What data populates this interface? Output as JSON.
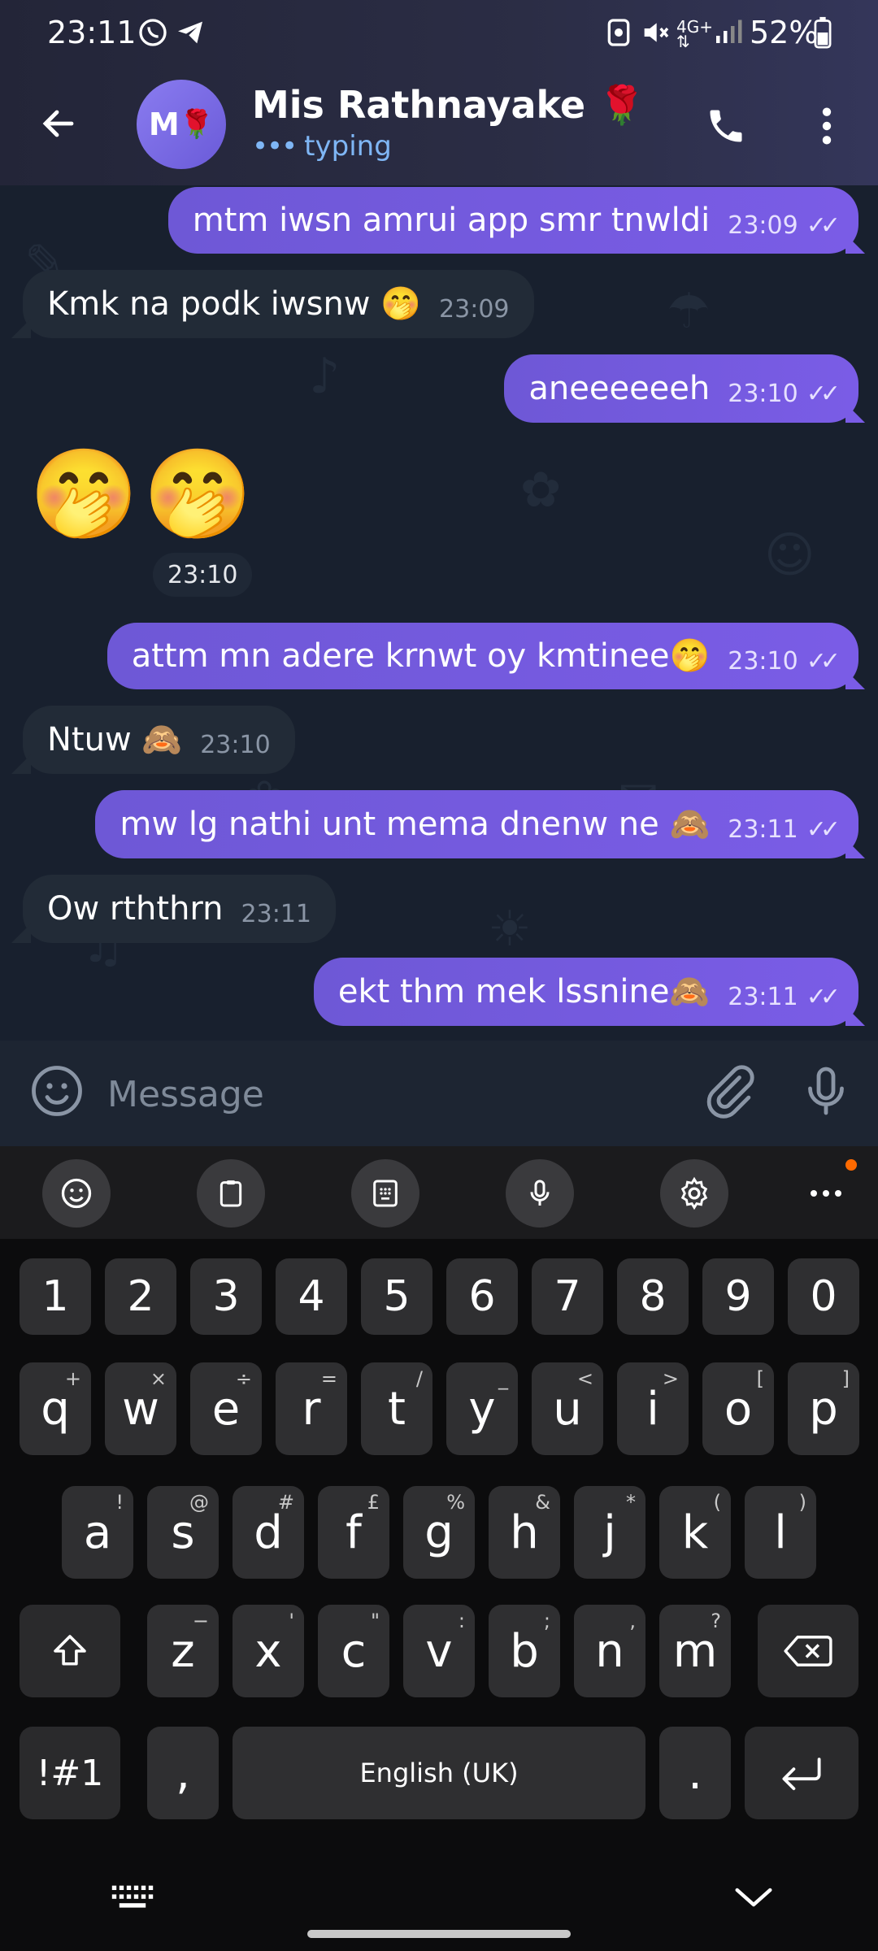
{
  "status_bar": {
    "time": "23:11",
    "battery": "52%",
    "network": "4G+"
  },
  "header": {
    "avatar_initial": "M",
    "avatar_emoji": "🌹",
    "name": "Mis Rathnayake 🌹",
    "status_text": "typing"
  },
  "messages": [
    {
      "dir": "out",
      "text": "mtm iwsn amrui app smr tnwldi",
      "time": "23:09",
      "read": true
    },
    {
      "dir": "in",
      "text": "Kmk na podk iwsnw 🤭",
      "time": "23:09"
    },
    {
      "dir": "out",
      "text": "aneeeeeeh",
      "time": "23:10",
      "read": true
    },
    {
      "dir": "in",
      "emoji_only": [
        "🤭",
        "🤭"
      ],
      "time": "23:10"
    },
    {
      "dir": "out",
      "text": "attm mn adere krnwt oy kmtinee🤭",
      "time": "23:10",
      "read": true
    },
    {
      "dir": "in",
      "text": "Ntuw 🙈",
      "time": "23:10"
    },
    {
      "dir": "out",
      "text": "mw lg nathi unt mema dnenw ne 🙈",
      "time": "23:11",
      "read": true
    },
    {
      "dir": "in",
      "text": "Ow rththrn",
      "time": "23:11"
    },
    {
      "dir": "out",
      "text": "ekt thm mek lssnine🙈",
      "time": "23:11",
      "read": true
    }
  ],
  "composer": {
    "placeholder": "Message"
  },
  "keyboard": {
    "numbers": [
      "1",
      "2",
      "3",
      "4",
      "5",
      "6",
      "7",
      "8",
      "9",
      "0"
    ],
    "row1": [
      {
        "k": "q",
        "h": "+"
      },
      {
        "k": "w",
        "h": "×"
      },
      {
        "k": "e",
        "h": "÷"
      },
      {
        "k": "r",
        "h": "="
      },
      {
        "k": "t",
        "h": "/"
      },
      {
        "k": "y",
        "h": "_"
      },
      {
        "k": "u",
        "h": "<"
      },
      {
        "k": "i",
        "h": ">"
      },
      {
        "k": "o",
        "h": "["
      },
      {
        "k": "p",
        "h": "]"
      }
    ],
    "row2": [
      {
        "k": "a",
        "h": "!"
      },
      {
        "k": "s",
        "h": "@"
      },
      {
        "k": "d",
        "h": "#"
      },
      {
        "k": "f",
        "h": "£"
      },
      {
        "k": "g",
        "h": "%"
      },
      {
        "k": "h",
        "h": "&"
      },
      {
        "k": "j",
        "h": "*"
      },
      {
        "k": "k",
        "h": "("
      },
      {
        "k": "l",
        "h": ")"
      }
    ],
    "row3": [
      {
        "k": "z",
        "h": "−"
      },
      {
        "k": "x",
        "h": "'"
      },
      {
        "k": "c",
        "h": "\""
      },
      {
        "k": "v",
        "h": ":"
      },
      {
        "k": "b",
        "h": ";"
      },
      {
        "k": "n",
        "h": ","
      },
      {
        "k": "m",
        "h": "?"
      }
    ],
    "symbols_label": "!#1",
    "comma": ",",
    "space_label": "English (UK)",
    "period": "."
  },
  "icons": {
    "back": "arrow-left",
    "call": "phone",
    "menu": "more-vertical",
    "emoji": "smiley",
    "attach": "paperclip",
    "mic": "microphone",
    "toolbar": [
      "emoji",
      "clipboard",
      "keypad",
      "voice",
      "settings",
      "more"
    ]
  },
  "colors": {
    "accent": "#7a5ce6",
    "typing": "#7fb6f5",
    "chat_bg": "#18202e",
    "incoming": "#222b37"
  }
}
